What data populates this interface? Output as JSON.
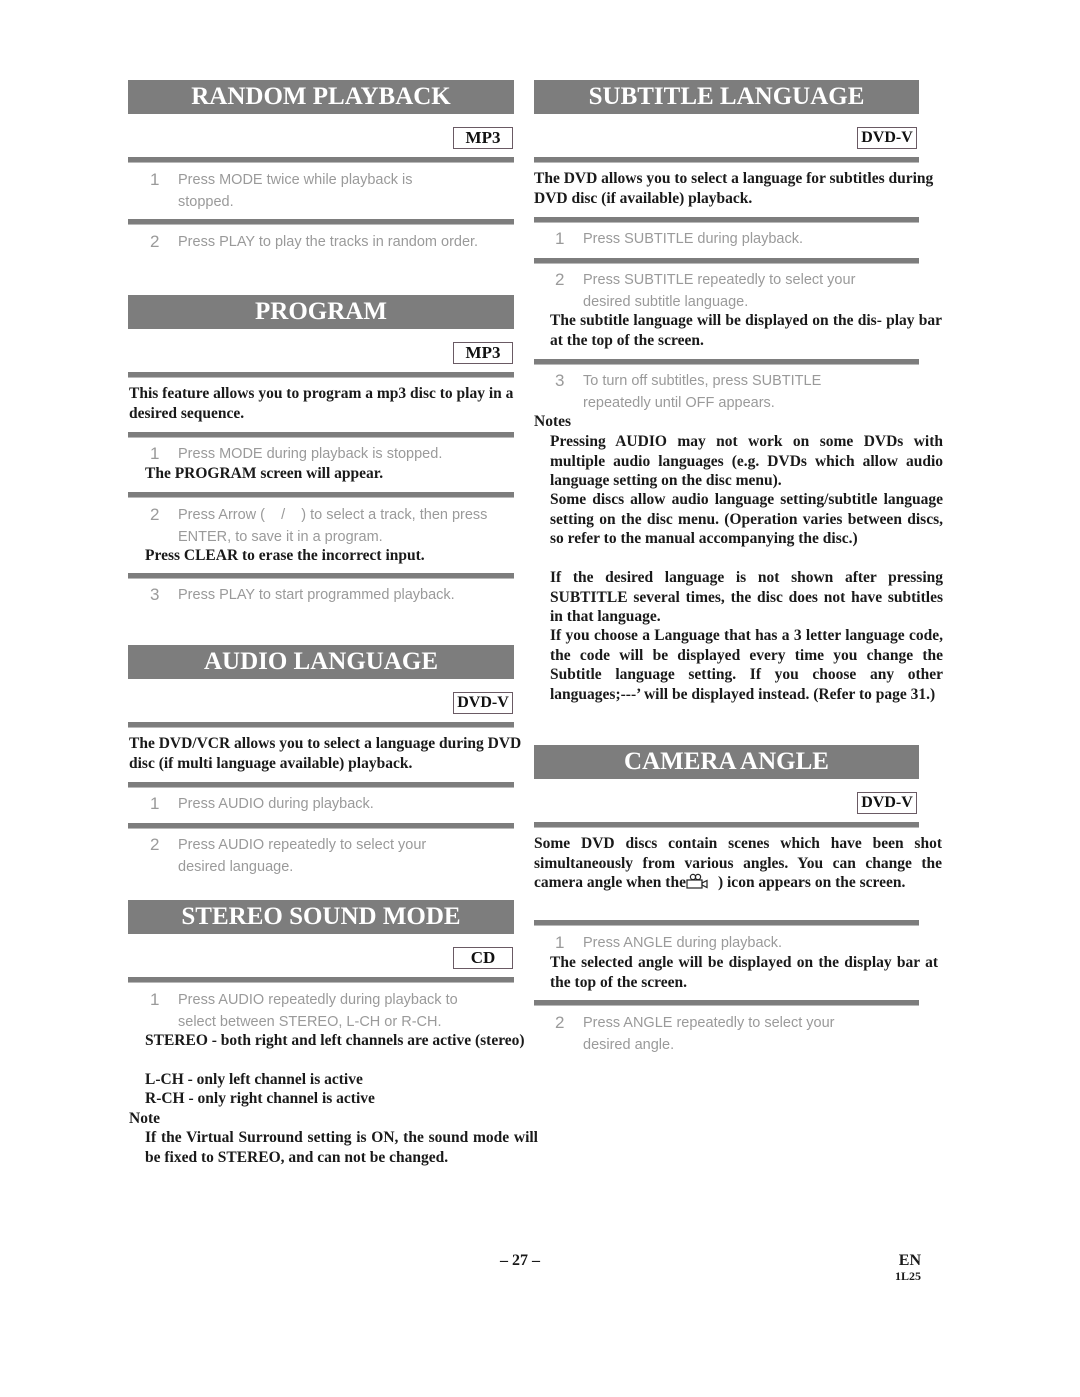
{
  "sections": {
    "random": {
      "title": "RANDOM PLAYBACK",
      "badge": "MP3",
      "steps": [
        {
          "num": "1",
          "text": "Press MODE twice while playback is stopped."
        },
        {
          "num": "2",
          "text": "Press PLAY to play the tracks in random order."
        }
      ]
    },
    "program": {
      "title": "PROGRAM",
      "badge": "MP3",
      "intro": "This feature allows you to program a mp3 disc to play in a desired sequence.",
      "steps": [
        {
          "num": "1",
          "text": "Press MODE during playback is stopped.",
          "note": "The PROGRAM screen will appear."
        },
        {
          "num": "2",
          "text": "Press Arrow (    /    ) to select a track, then press ENTER, to save it in a program.",
          "note": "Press CLEAR to erase the incorrect input."
        },
        {
          "num": "3",
          "text": "Press PLAY to start programmed playback."
        }
      ]
    },
    "audio": {
      "title": "AUDIO LANGUAGE",
      "badge": "DVD-V",
      "intro": "The DVD/VCR allows you to select a language during DVD disc (if multi language available) playback.",
      "steps": [
        {
          "num": "1",
          "text": "Press AUDIO during playback."
        },
        {
          "num": "2",
          "text": "Press AUDIO repeatedly to select your desired language."
        }
      ]
    },
    "stereo": {
      "title": "STEREO SOUND MODE",
      "badge": "CD",
      "steps": [
        {
          "num": "1",
          "text": "Press AUDIO repeatedly during playback to select between STEREO, L-CH or R-CH."
        }
      ],
      "modes": [
        "STEREO - both right and left channels are active (stereo)",
        "L-CH - only left channel is active",
        "R-CH - only right channel is active"
      ],
      "note_label": "Note",
      "note": "If the Virtual Surround setting is ON, the sound mode will be fixed to STEREO, and can not be changed."
    },
    "subtitle": {
      "title": "SUBTITLE LANGUAGE",
      "badge": "DVD-V",
      "intro": "The DVD allows you to select a language for subtitles during DVD disc (if available) playback.",
      "steps": [
        {
          "num": "1",
          "text": "Press SUBTITLE during playback."
        },
        {
          "num": "2",
          "text": "Press SUBTITLE repeatedly to select your desired subtitle language.",
          "note": "The subtitle language will be displayed on the dis- play bar at the top of the screen."
        },
        {
          "num": "3",
          "text": "To turn off subtitles, press SUBTITLE repeatedly until OFF appears."
        }
      ],
      "notes_label": "Notes",
      "notes": [
        "Pressing AUDIO may not work on some DVDs with multiple audio languages (e.g. DVDs which allow audio language setting on the disc menu).",
        "Some discs allow audio language setting/subtitle language setting on the disc menu. (Operation varies between discs, so refer to the manual accompanying the disc.)",
        "If the desired language is not shown after pressing SUBTITLE several times, the disc does not have subtitles in that language.",
        "If you choose a Language that has a 3 letter language code, the code will be displayed every time you change the Subtitle language setting. If you choose any other languages;---’ will be displayed instead. (Refer to page 31.)"
      ]
    },
    "camera": {
      "title": "CAMERA ANGLE",
      "badge": "DVD-V",
      "intro_before": "Some DVD discs contain scenes which have been shot simultaneously from various angles. You can change the camera angle when the",
      "intro_icon": "camera-angle-icon",
      "intro_after": ") icon appears on the screen.",
      "steps": [
        {
          "num": "1",
          "text": "Press ANGLE during playback.",
          "note": "The selected angle will be displayed on the display bar at the top of the screen."
        },
        {
          "num": "2",
          "text": "Press ANGLE repeatedly to select your desired angle."
        }
      ]
    }
  },
  "footer": {
    "page_number": "– 27 –",
    "lang": "EN",
    "code": "1L25"
  }
}
